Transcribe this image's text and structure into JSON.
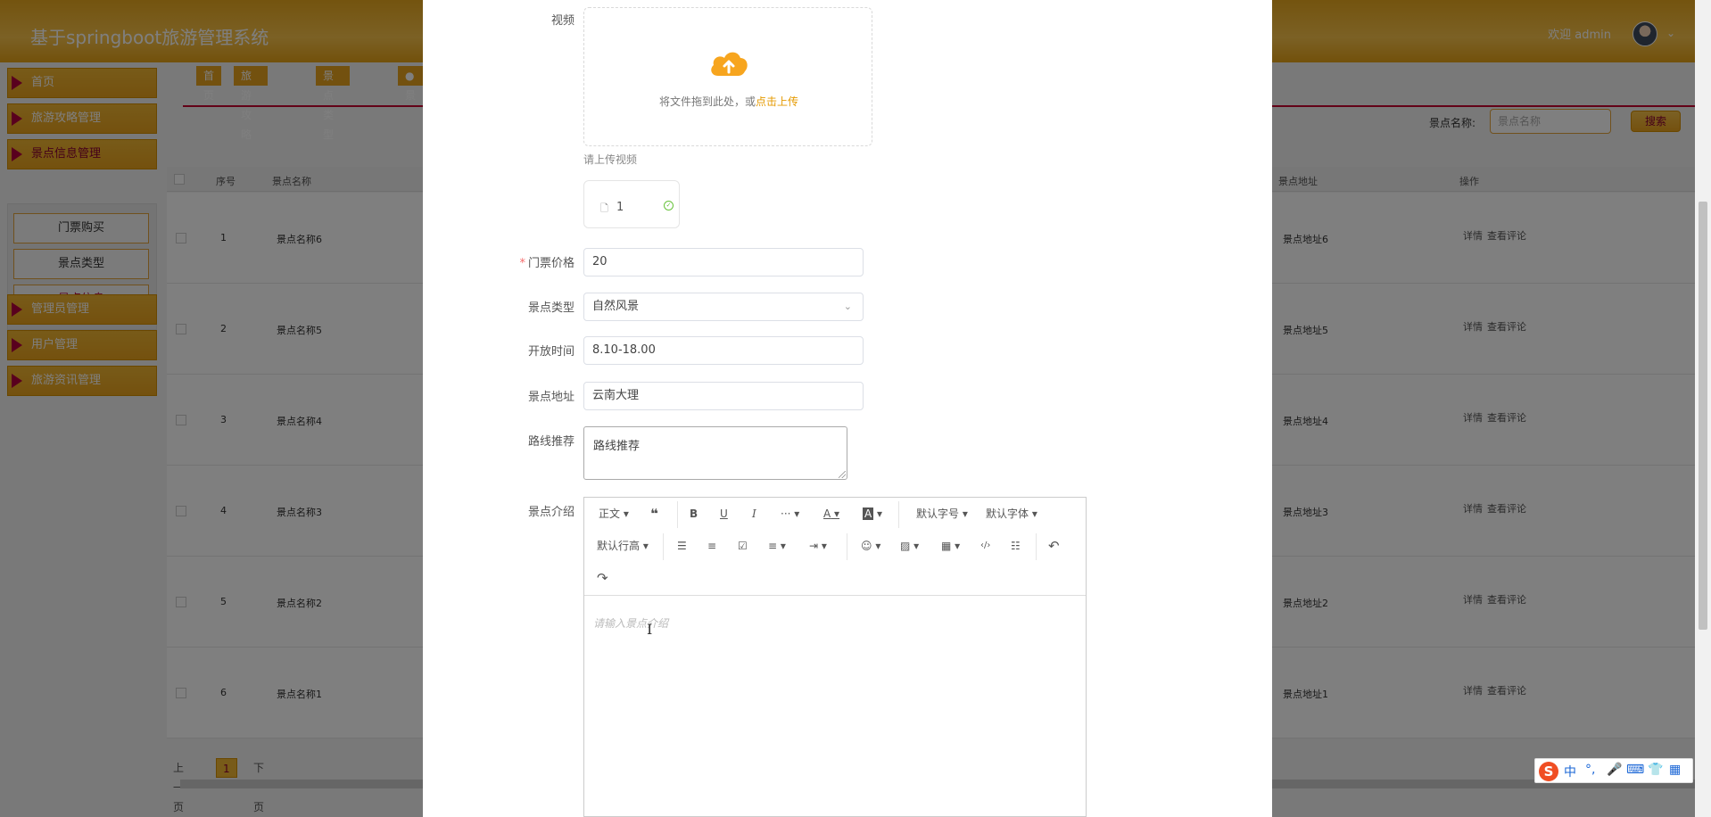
{
  "app": {
    "title": "基于springboot旅游管理系统",
    "welcome": "欢迎 admin"
  },
  "sidebar": {
    "menus": [
      {
        "label": "首页"
      },
      {
        "label": "旅游攻略管理"
      },
      {
        "label": "景点信息管理"
      },
      {
        "label": "管理员管理"
      },
      {
        "label": "用户管理"
      },
      {
        "label": "旅游资讯管理"
      }
    ],
    "submenu": [
      {
        "label": "门票购买"
      },
      {
        "label": "景点类型"
      },
      {
        "label": "景点信息"
      }
    ]
  },
  "tabs": [
    "首页",
    "旅游攻略",
    "景点类型",
    "●景"
  ],
  "search": {
    "label": "景点名称:",
    "placeholder": "景点名称",
    "button": "搜索"
  },
  "table": {
    "headers": {
      "index": "序号",
      "name": "景点名称",
      "address": "景点地址",
      "ops": "操作"
    },
    "rows": [
      {
        "index": "1",
        "name": "景点名称6",
        "address": "景点地址6"
      },
      {
        "index": "2",
        "name": "景点名称5",
        "address": "景点地址5"
      },
      {
        "index": "3",
        "name": "景点名称4",
        "address": "景点地址4"
      },
      {
        "index": "4",
        "name": "景点名称3",
        "address": "景点地址3"
      },
      {
        "index": "5",
        "name": "景点名称2",
        "address": "景点地址2"
      },
      {
        "index": "6",
        "name": "景点名称1",
        "address": "景点地址1"
      }
    ],
    "op_detail": "详情",
    "op_comments": "查看评论"
  },
  "pager": {
    "prev": "上一页",
    "current": "1",
    "next": "下一页"
  },
  "form": {
    "video_label": "视频",
    "upload_text": "将文件拖到此处，或",
    "upload_link": "点击上传",
    "upload_tip": "请上传视频",
    "file_name": "1",
    "price_label": "门票价格",
    "price_value": "20",
    "type_label": "景点类型",
    "type_value": "自然风景",
    "open_label": "开放时间",
    "open_value": "8.10-18.00",
    "address_label": "景点地址",
    "address_value": "云南大理",
    "route_label": "路线推荐",
    "route_value": "路线推荐",
    "intro_label": "景点介绍",
    "intro_placeholder": "请输入景点介绍"
  },
  "editor_toolbar": {
    "para": "正文",
    "quote": "❝",
    "bold": "B",
    "underline": "U",
    "italic": "I",
    "more": "···",
    "font_color": "A",
    "bg_color": "A",
    "font_size": "默认字号",
    "font_family": "默认字体",
    "line_height": "默认行高",
    "code": "‹/›",
    "undo": "↶",
    "redo": "↷"
  },
  "ime": {
    "logo": "S",
    "lang": "中"
  },
  "colors": {
    "accent": "#e9a21d",
    "brand_dark": "#b3003c",
    "upload_orange": "#f7a51e"
  }
}
